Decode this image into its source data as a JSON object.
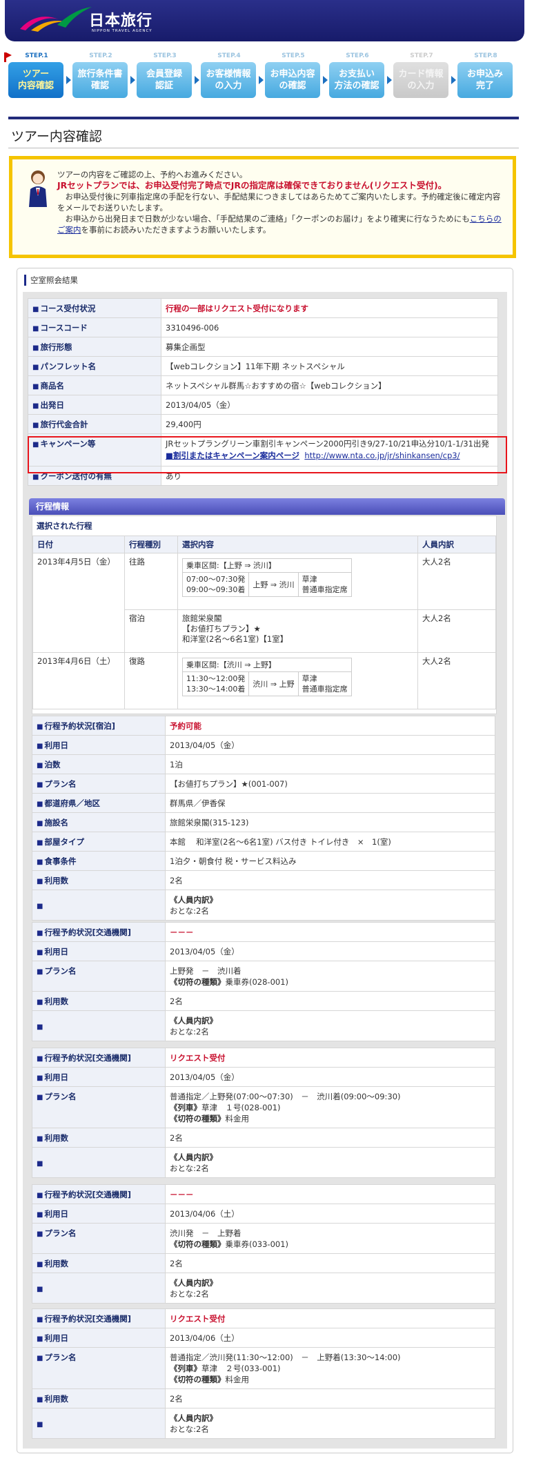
{
  "header": {
    "logo_text": "日本旅行",
    "logo_sub": "NIPPON TRAVEL AGENCY"
  },
  "steps": [
    {
      "num": "STEP.1",
      "label": "ツアー\n内容確認",
      "state": "active"
    },
    {
      "num": "STEP.2",
      "label": "旅行条件書\n確認",
      "state": "normal"
    },
    {
      "num": "STEP.3",
      "label": "会員登録\n認証",
      "state": "normal"
    },
    {
      "num": "STEP.4",
      "label": "お客様情報\nの入力",
      "state": "normal"
    },
    {
      "num": "STEP.5",
      "label": "お申込内容\nの確認",
      "state": "normal"
    },
    {
      "num": "STEP.6",
      "label": "お支払い\n方法の確認",
      "state": "normal"
    },
    {
      "num": "STEP.7",
      "label": "カード情報\nの入力",
      "state": "disabled"
    },
    {
      "num": "STEP.8",
      "label": "お申込み\n完了",
      "state": "normal"
    }
  ],
  "page_title": "ツアー内容確認",
  "notice": {
    "line1": "ツアーの内容をご確認の上、予約へお進みください。",
    "line2": "JRセットプランでは、お申込受付完了時点でJRの指定席は確保できておりません(リクエスト受付)。",
    "line3": "　お申込受付後に列車指定席の手配を行ない、手配結果につきましてはあらためてご案内いたします。予約確定後に確定内容をメールでお送りいたします。",
    "line4a": "　お申込から出発日まで日数が少ない場合、「手配結果のご連絡」「クーポンのお届け」をより確実に行なうためにも",
    "line4_link": "こちらのご案内",
    "line4b": "を事前にお読みいただきますようお願いいたします。"
  },
  "result_title": "空室照会結果",
  "summary": [
    {
      "k": "コース受付状況",
      "v": "行程の一部はリクエスト受付になります",
      "red": true
    },
    {
      "k": "コースコード",
      "v": "3310496-006"
    },
    {
      "k": "旅行形態",
      "v": "募集企画型"
    },
    {
      "k": "パンフレット名",
      "v": "【webコレクション】11年下期 ネットスペシャル"
    },
    {
      "k": "商品名",
      "v": "ネットスペシャル群馬☆おすすめの宿☆【webコレクション】"
    },
    {
      "k": "出発日",
      "v": "2013/04/05（金）"
    },
    {
      "k": "旅行代金合計",
      "v": "29,400円"
    }
  ],
  "campaign": {
    "k": "キャンペーン等",
    "v": "JRセットプラングリーン車割引キャンペーン2000円引き9/27-10/21申込分10/1-1/31出発",
    "link_label": "■割引またはキャンペーン案内ページ",
    "url": "http://www.nta.co.jp/jr/shinkansen/cp3/"
  },
  "coupon": {
    "k": "クーポン送付の有無",
    "v": "あり"
  },
  "itinerary": {
    "header": "行程情報",
    "subtitle": "選択された行程",
    "columns": [
      "日付",
      "行程種別",
      "選択内容",
      "人員内訳"
    ],
    "rows": [
      {
        "date": "2013年4月5日（金）",
        "type": "往路",
        "section": "乗車区間:【上野 ⇒ 渋川】",
        "time1": "07:00～07:30発",
        "time2": "09:00～09:30着",
        "route": "上野 ⇒ 渋川",
        "train": "草津",
        "seat": "普通車指定席",
        "people": "大人2名"
      },
      {
        "type": "宿泊",
        "hotel1": "旅館栄泉閣",
        "hotel2": "【お値打ちプラン】★",
        "hotel3": "和洋室(2名～6名1室)【1室】",
        "people": "大人2名"
      },
      {
        "date": "2013年4月6日（土）",
        "type": "復路",
        "section": "乗車区間:【渋川 ⇒ 上野】",
        "time1": "11:30～12:00発",
        "time2": "13:30～14:00着",
        "route": "渋川 ⇒ 上野",
        "train": "草津",
        "seat": "普通車指定席",
        "people": "大人2名"
      }
    ]
  },
  "stay": {
    "status_k": "行程予約状況[宿泊]",
    "status_v": "予約可能",
    "rows": [
      {
        "k": "利用日",
        "v": "2013/04/05（金）"
      },
      {
        "k": "泊数",
        "v": "1泊"
      },
      {
        "k": "プラン名",
        "v": "【お値打ちプラン】★(001-007)"
      },
      {
        "k": "都道府県／地区",
        "v": "群馬県／伊香保"
      },
      {
        "k": "施設名",
        "v": "旅館栄泉閣(315-123)"
      },
      {
        "k": "部屋タイプ",
        "v": "本館　 和洋室(2名～6名1室) バス付き トイレ付き　×　1(室)"
      },
      {
        "k": "食事条件",
        "v": "1泊夕・朝食付 税・サービス料込み"
      }
    ],
    "count_k": "利用数",
    "count_v": "2名",
    "breakdown_label": "《人員内訳》",
    "breakdown_v": "おとな:2名"
  },
  "transport": [
    {
      "status_k": "行程予約状況[交通機関]",
      "status_v": "－－－",
      "date_k": "利用日",
      "date_v": "2013/04/05（金）",
      "plan_k": "プラン名",
      "plan_l1": "上野発　－　渋川着",
      "plan_l2_label": "《切符の種類》",
      "plan_l2": "乗車券(028-001)",
      "plan_l3_label": "",
      "plan_l3": "",
      "count_k": "利用数",
      "count_v": "2名",
      "breakdown_label": "《人員内訳》",
      "breakdown_v": "おとな:2名"
    },
    {
      "status_k": "行程予約状況[交通機関]",
      "status_v": "リクエスト受付",
      "date_k": "利用日",
      "date_v": "2013/04/05（金）",
      "plan_k": "プラン名",
      "plan_l1": "普通指定／上野発(07:00～07:30)　－　渋川着(09:00～09:30)",
      "plan_l2_label": "《列車》",
      "plan_l2": "草津　１号(028-001)",
      "plan_l3_label": "《切符の種類》",
      "plan_l3": "料金用",
      "count_k": "利用数",
      "count_v": "2名",
      "breakdown_label": "《人員内訳》",
      "breakdown_v": "おとな:2名"
    },
    {
      "status_k": "行程予約状況[交通機関]",
      "status_v": "－－－",
      "date_k": "利用日",
      "date_v": "2013/04/06（土）",
      "plan_k": "プラン名",
      "plan_l1": "渋川発　－　上野着",
      "plan_l2_label": "《切符の種類》",
      "plan_l2": "乗車券(033-001)",
      "plan_l3_label": "",
      "plan_l3": "",
      "count_k": "利用数",
      "count_v": "2名",
      "breakdown_label": "《人員内訳》",
      "breakdown_v": "おとな:2名"
    },
    {
      "status_k": "行程予約状況[交通機関]",
      "status_v": "リクエスト受付",
      "date_k": "利用日",
      "date_v": "2013/04/06（土）",
      "plan_k": "プラン名",
      "plan_l1": "普通指定／渋川発(11:30～12:00)　－　上野着(13:30～14:00)",
      "plan_l2_label": "《列車》",
      "plan_l2": "草津　２号(033-001)",
      "plan_l3_label": "《切符の種類》",
      "plan_l3": "料金用",
      "count_k": "利用数",
      "count_v": "2名",
      "breakdown_label": "《人員内訳》",
      "breakdown_v": "おとな:2名"
    }
  ]
}
